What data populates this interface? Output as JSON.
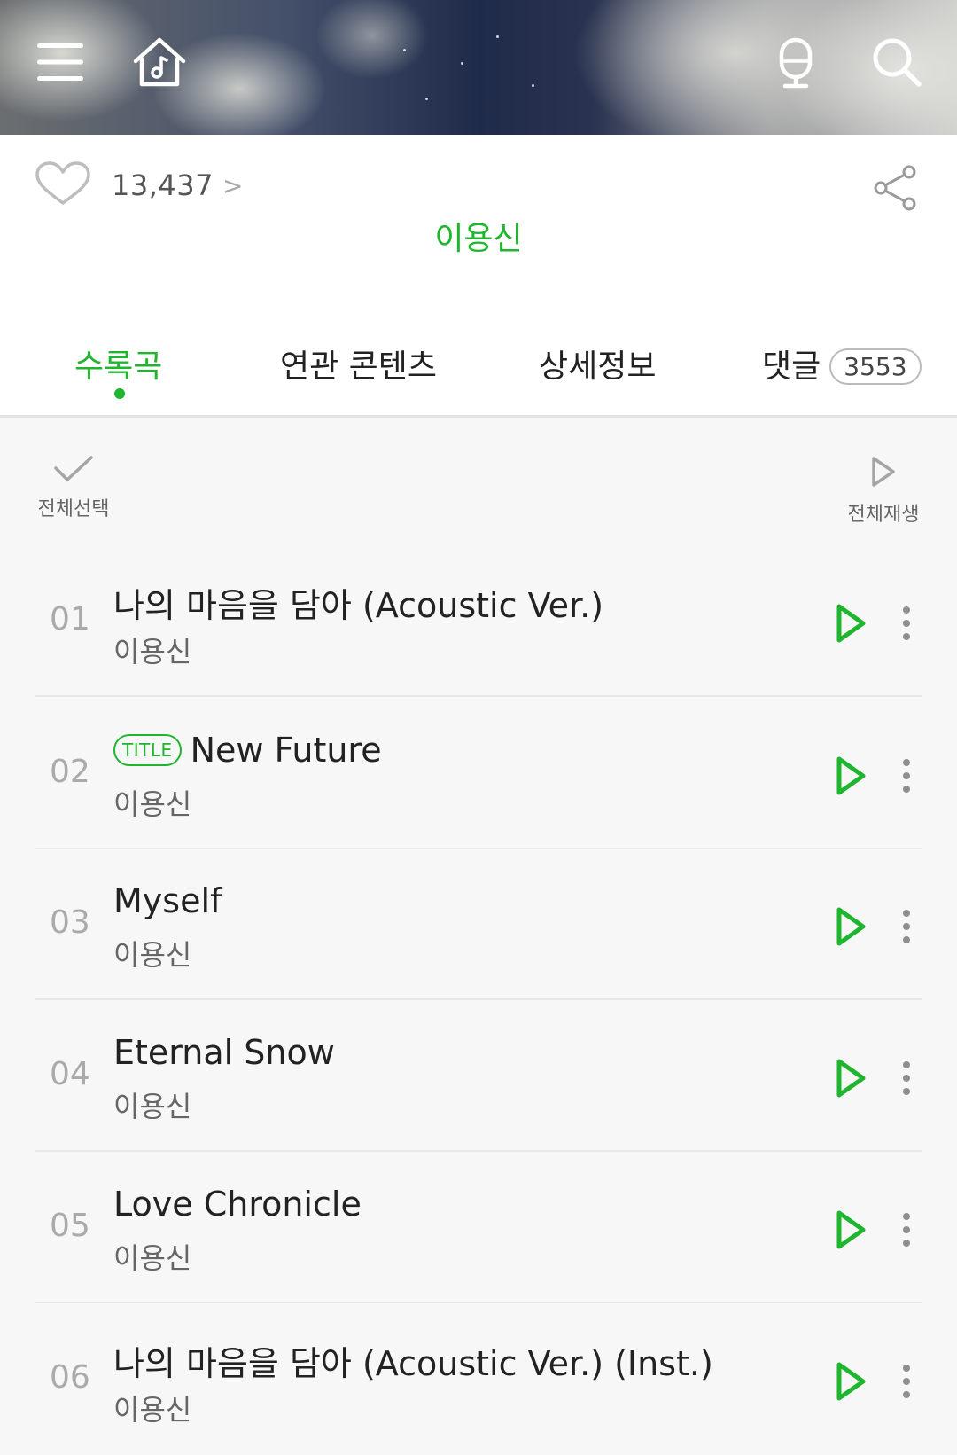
{
  "header": {
    "icons": [
      "menu-icon",
      "home-music-icon",
      "microphone-icon",
      "search-icon"
    ]
  },
  "info": {
    "like_count": "13,437",
    "like_chevron": ">",
    "artist": "이용신"
  },
  "tabs": [
    {
      "label": "수록곡",
      "active": true
    },
    {
      "label": "연관 콘텐츠",
      "active": false
    },
    {
      "label": "상세정보",
      "active": false
    },
    {
      "label": "댓글",
      "active": false,
      "badge": "3553"
    }
  ],
  "actions": {
    "select_all": "전체선택",
    "play_all": "전체재생"
  },
  "tracks": [
    {
      "num": "01",
      "title": "나의 마음을 담아 (Acoustic Ver.)",
      "artist": "이용신"
    },
    {
      "num": "02",
      "badge": "TITLE",
      "title": "New Future",
      "artist": "이용신"
    },
    {
      "num": "03",
      "title": "Myself",
      "artist": "이용신"
    },
    {
      "num": "04",
      "title": "Eternal Snow",
      "artist": "이용신"
    },
    {
      "num": "05",
      "title": "Love Chronicle",
      "artist": "이용신"
    },
    {
      "num": "06",
      "title": "나의 마음을 담아 (Acoustic Ver.) (Inst.)",
      "artist": "이용신"
    }
  ],
  "colors": {
    "accent": "#1fb52f",
    "muted_text": "#666666",
    "track_number": "#aaaaaa"
  }
}
